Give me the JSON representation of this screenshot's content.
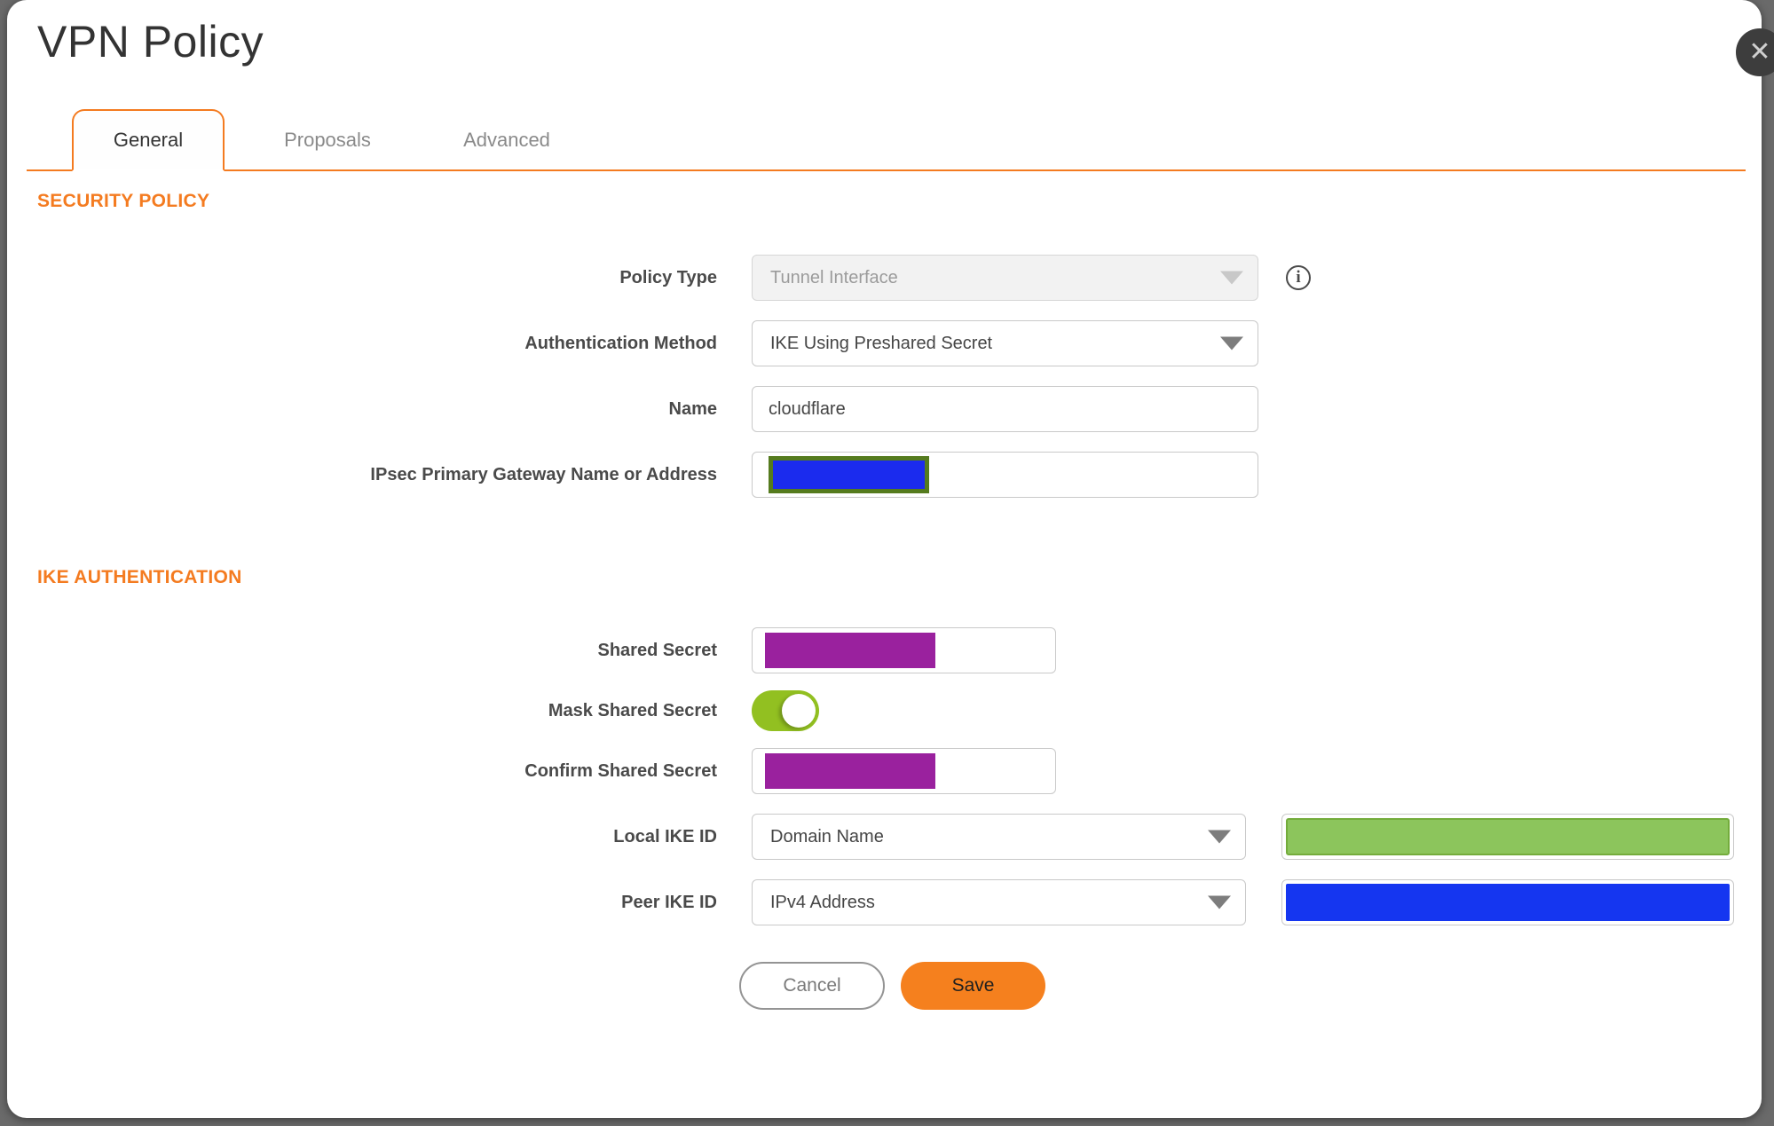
{
  "dialog": {
    "title": "VPN Policy",
    "close_label": "✕"
  },
  "tabs": {
    "items": [
      {
        "label": "General",
        "active": true
      },
      {
        "label": "Proposals",
        "active": false
      },
      {
        "label": "Advanced",
        "active": false
      }
    ]
  },
  "security_policy": {
    "heading": "SECURITY POLICY",
    "policy_type": {
      "label": "Policy Type",
      "value": "Tunnel Interface",
      "disabled": true,
      "info_icon": "i"
    },
    "auth_method": {
      "label": "Authentication Method",
      "value": "IKE Using Preshared Secret"
    },
    "name": {
      "label": "Name",
      "value": "cloudflare"
    },
    "gateway": {
      "label": "IPsec Primary Gateway Name or Address",
      "value_redacted": true
    }
  },
  "ike_authentication": {
    "heading": "IKE AUTHENTICATION",
    "shared_secret": {
      "label": "Shared Secret",
      "value_redacted": true
    },
    "mask_shared_secret": {
      "label": "Mask Shared Secret",
      "enabled": true
    },
    "confirm_shared_secret": {
      "label": "Confirm Shared Secret",
      "value_redacted": true
    },
    "local_ike_id": {
      "label": "Local IKE ID",
      "value": "Domain Name",
      "id_value_redacted": true
    },
    "peer_ike_id": {
      "label": "Peer IKE ID",
      "value": "IPv4 Address",
      "id_value_redacted": true
    }
  },
  "actions": {
    "cancel": "Cancel",
    "save": "Save"
  },
  "colors": {
    "accent_orange": "#F47B20",
    "save_orange": "#F5801E",
    "toggle_green": "#92C021",
    "redaction_purple": "#9A219E",
    "redaction_blue": "#1536F0",
    "redaction_blue_border_olive": "#557B1E",
    "redaction_green": "#8CC55C",
    "redaction_green_border": "#74AC3C"
  }
}
